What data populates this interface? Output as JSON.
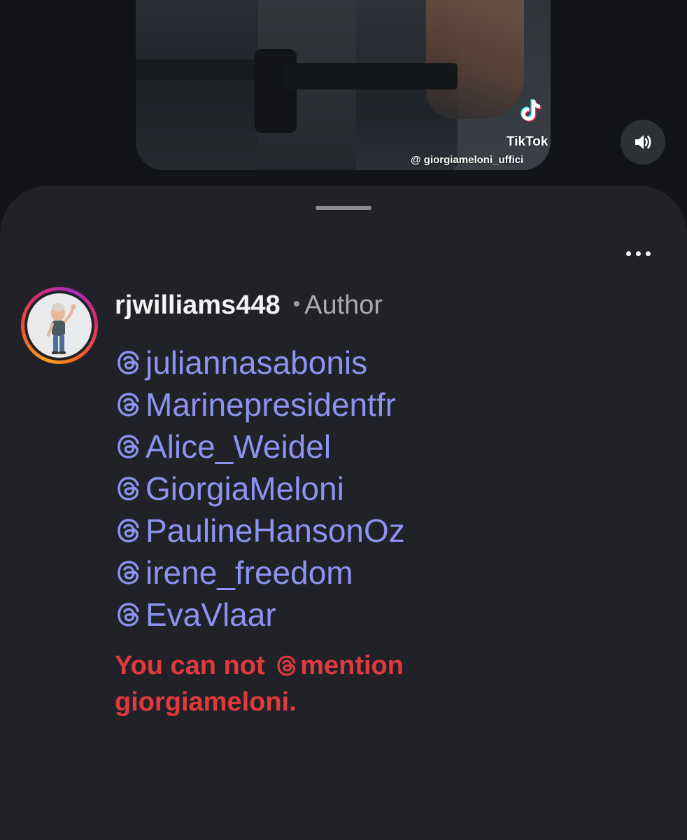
{
  "video": {
    "watermark_brand": "TikTok",
    "watermark_handle": "@ giorgiameloni_uffici",
    "sound_button_icon": "speaker-volume-icon"
  },
  "sheet": {
    "drag_handle": "drag-handle",
    "more_icon": "more-horizontal-icon"
  },
  "comment": {
    "avatar": "memoji-avatar",
    "username": "rjwilliams448",
    "separator": "•",
    "role": "Author",
    "mention_icon": "threads-at-icon",
    "mentions": [
      "juliannasabonis",
      "Marinepresidentfr",
      "Alice_Weidel",
      "GiorgiaMeloni",
      "PaulineHansonOz",
      "irene_freedom",
      "EvaVlaar"
    ],
    "error_prefix": "You can not",
    "error_word": "mention",
    "error_suffix": "giorgiameloni."
  },
  "colors": {
    "background": "#121418",
    "sheet": "#212227",
    "mention": "#8d93f2",
    "error": "#e03a3e",
    "username": "#f3f3f3",
    "role": "#a9abaf"
  }
}
